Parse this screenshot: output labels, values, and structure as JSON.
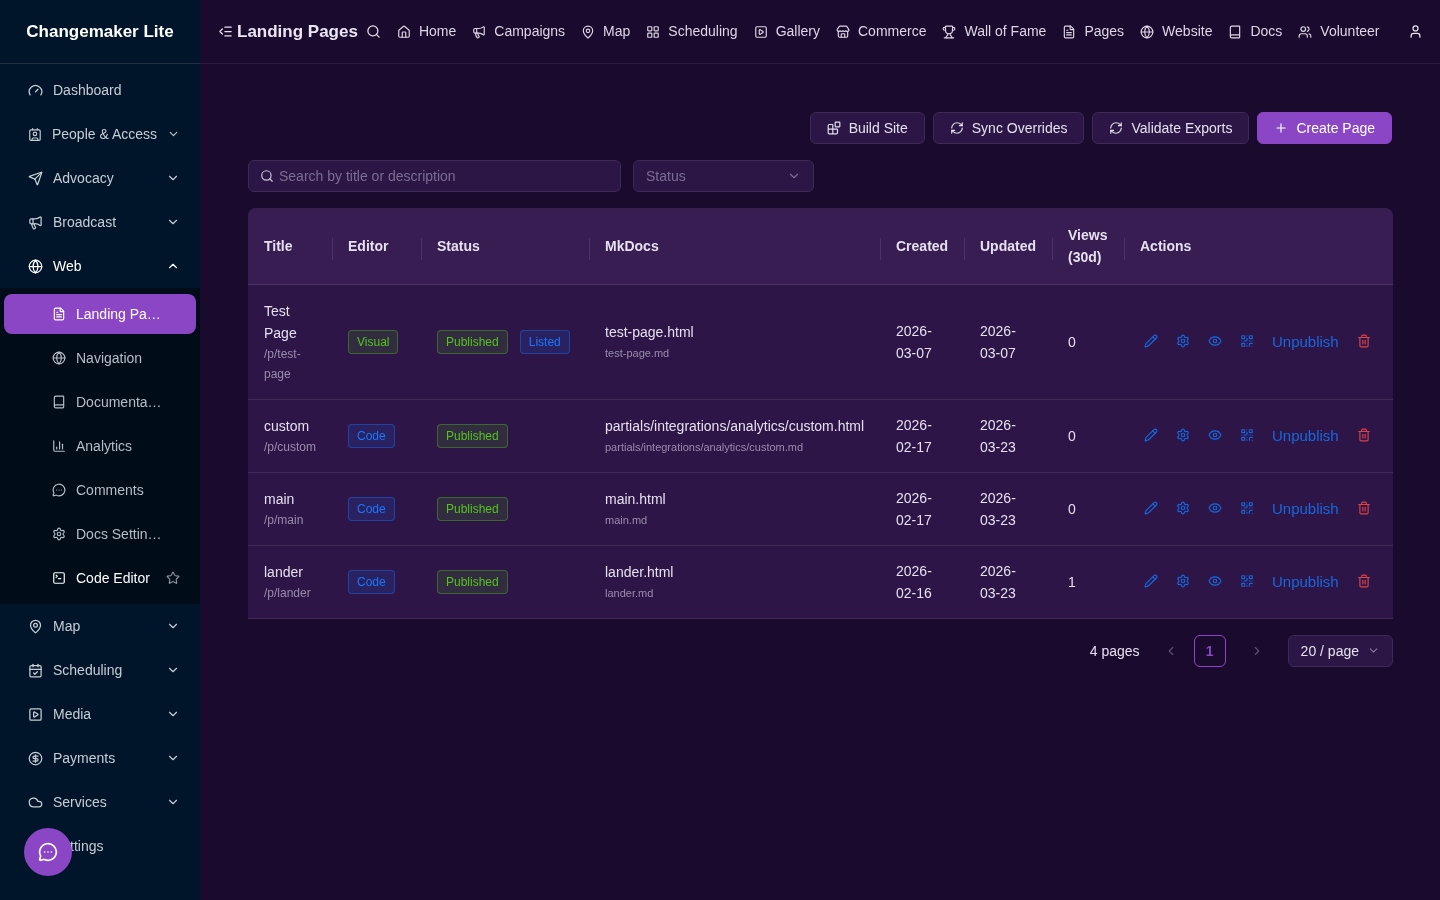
{
  "app": {
    "name": "Changemaker Lite"
  },
  "topbar": {
    "title": "Landing Pages",
    "nav": [
      {
        "label": "Home"
      },
      {
        "label": "Campaigns"
      },
      {
        "label": "Map"
      },
      {
        "label": "Scheduling"
      },
      {
        "label": "Gallery"
      },
      {
        "label": "Commerce"
      },
      {
        "label": "Wall of Fame"
      },
      {
        "label": "Pages"
      },
      {
        "label": "Website"
      },
      {
        "label": "Docs"
      },
      {
        "label": "Volunteer"
      }
    ]
  },
  "sidebar": {
    "items": [
      {
        "label": "Dashboard",
        "kind": "link"
      },
      {
        "label": "People & Access",
        "kind": "group",
        "expanded": false
      },
      {
        "label": "Advocacy",
        "kind": "group",
        "expanded": false
      },
      {
        "label": "Broadcast",
        "kind": "group",
        "expanded": false
      },
      {
        "label": "Web",
        "kind": "group",
        "expanded": true,
        "children": [
          {
            "label": "Landing Pa…",
            "selected": true,
            "hovered": false
          },
          {
            "label": "Navigation",
            "selected": false,
            "hovered": false
          },
          {
            "label": "Documenta…",
            "selected": false,
            "hovered": false
          },
          {
            "label": "Analytics",
            "selected": false,
            "hovered": false
          },
          {
            "label": "Comments",
            "selected": false,
            "hovered": false
          },
          {
            "label": "Docs Settin…",
            "selected": false,
            "hovered": false
          },
          {
            "label": "Code Editor",
            "selected": false,
            "hovered": true
          }
        ]
      },
      {
        "label": "Map",
        "kind": "group",
        "expanded": false
      },
      {
        "label": "Scheduling",
        "kind": "group",
        "expanded": false
      },
      {
        "label": "Media",
        "kind": "group",
        "expanded": false
      },
      {
        "label": "Payments",
        "kind": "group",
        "expanded": false
      },
      {
        "label": "Services",
        "kind": "group",
        "expanded": false
      },
      {
        "label": "ttings",
        "kind": "covered"
      }
    ]
  },
  "toolbar": {
    "buttons": [
      {
        "label": "Build Site",
        "kind": "build"
      },
      {
        "label": "Sync Overrides",
        "kind": "sync"
      },
      {
        "label": "Validate Exports",
        "kind": "sync"
      },
      {
        "label": "Create Page",
        "kind": "primary"
      }
    ]
  },
  "filters": {
    "search": {
      "placeholder": "Search by title or description"
    },
    "status": {
      "placeholder": "Status"
    }
  },
  "table": {
    "columns": [
      "Title",
      "Editor",
      "Status",
      "MkDocs",
      "Created",
      "Updated",
      "Views (30d)",
      "Actions"
    ],
    "rows": [
      {
        "title": "Test Page",
        "path": "/p/test-page",
        "editor": {
          "label": "Visual",
          "color": "#52c41a"
        },
        "status": [
          {
            "label": "Published",
            "color": "#52c41a"
          },
          {
            "label": "Listed",
            "color": "#1677ff"
          }
        ],
        "html": "test-page.html",
        "md": "test-page.md",
        "created": "2026-03-07",
        "updated": "2026-03-07",
        "views": "0",
        "action": "Unpublish"
      },
      {
        "title": "custom",
        "path": "/p/custom",
        "editor": {
          "label": "Code",
          "color": "#1677ff"
        },
        "status": [
          {
            "label": "Published",
            "color": "#52c41a"
          }
        ],
        "html": "partials/integrations/analytics/custom.html",
        "md": "partials/integrations/analytics/custom.md",
        "created": "2026-02-17",
        "updated": "2026-03-23",
        "views": "0",
        "action": "Unpublish"
      },
      {
        "title": "main",
        "path": "/p/main",
        "editor": {
          "label": "Code",
          "color": "#1677ff"
        },
        "status": [
          {
            "label": "Published",
            "color": "#52c41a"
          }
        ],
        "html": "main.html",
        "md": "main.md",
        "created": "2026-02-17",
        "updated": "2026-03-23",
        "views": "0",
        "action": "Unpublish"
      },
      {
        "title": "lander",
        "path": "/p/lander",
        "editor": {
          "label": "Code",
          "color": "#1677ff"
        },
        "status": [
          {
            "label": "Published",
            "color": "#52c41a"
          }
        ],
        "html": "lander.html",
        "md": "lander.md",
        "created": "2026-02-16",
        "updated": "2026-03-23",
        "views": "1",
        "action": "Unpublish"
      }
    ]
  },
  "pagination": {
    "total": "4 pages",
    "pages": [
      {
        "label": "1",
        "selected": true
      }
    ],
    "size": "20 / page"
  }
}
